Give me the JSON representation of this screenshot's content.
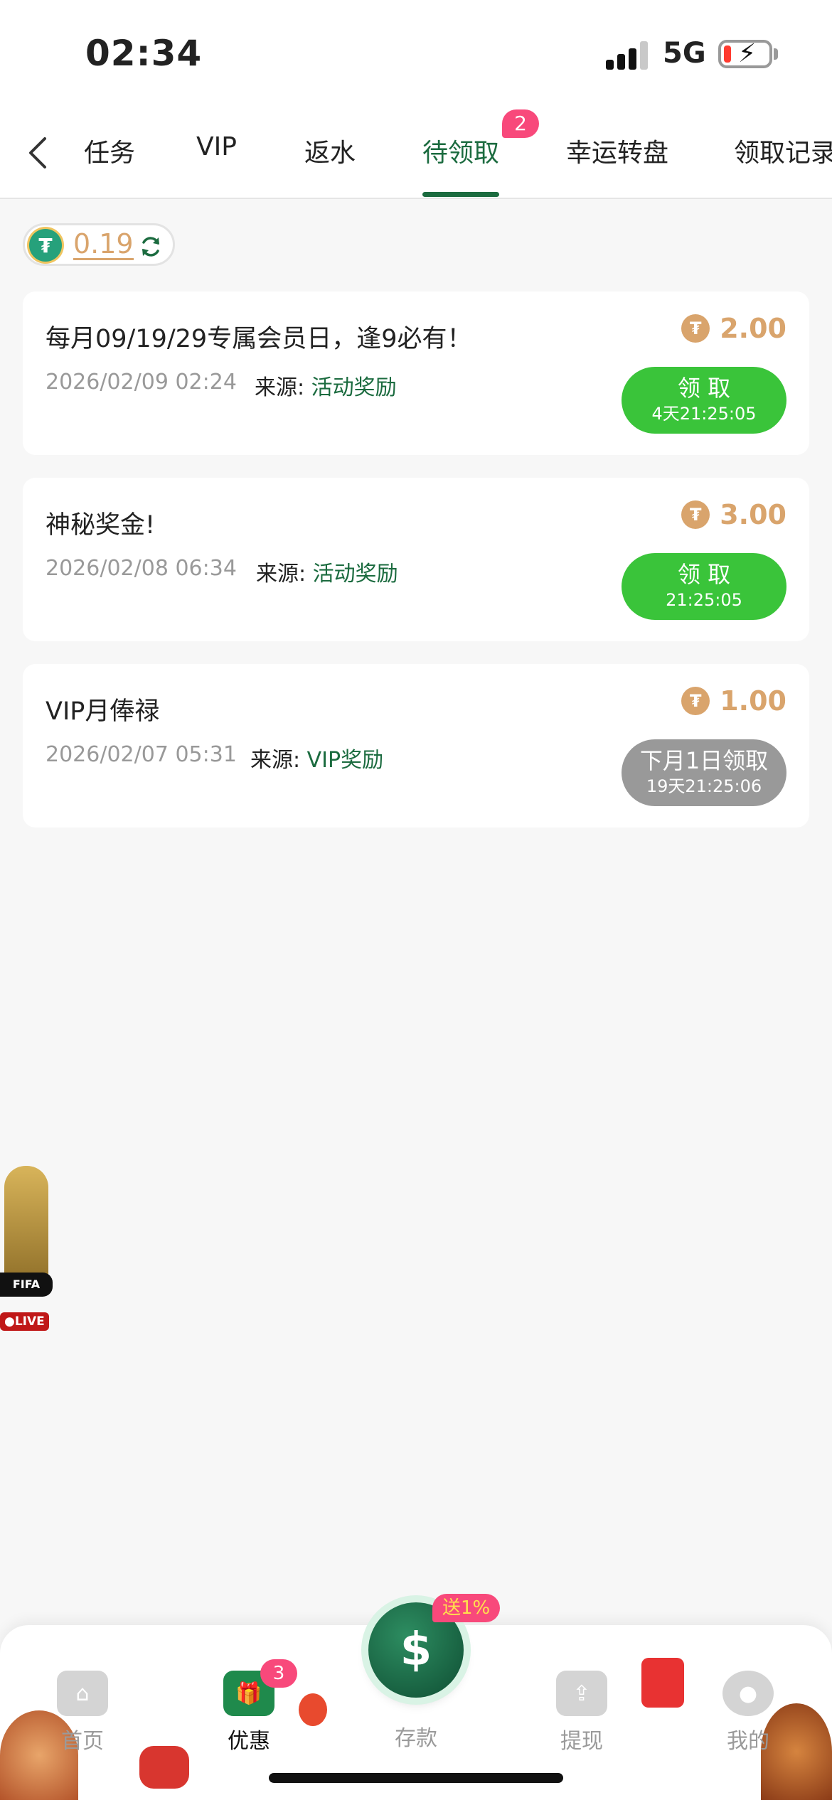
{
  "status_bar": {
    "time": "02:34",
    "network": "5G"
  },
  "tabs": [
    {
      "label": "任务"
    },
    {
      "label": "VIP"
    },
    {
      "label": "返水"
    },
    {
      "label": "待领取",
      "badge": "2"
    },
    {
      "label": "幸运转盘"
    },
    {
      "label": "领取记录"
    }
  ],
  "active_tab": "待领取",
  "balance": {
    "value": "0.19",
    "currency_icon": "usdt-icon"
  },
  "cards": [
    {
      "title": "每月09/19/29专属会员日，逢9必有！",
      "date": "2026/02/09 02:24",
      "source_label": "来源:",
      "source_value": "活动奖励",
      "amount": "2.00",
      "button_label": "领 取",
      "button_sub": "4天21:25:05",
      "button_state": "active"
    },
    {
      "title": "神秘奖金!",
      "date": "2026/02/08 06:34",
      "source_label": "来源:",
      "source_value": "活动奖励",
      "amount": "3.00",
      "button_label": "领 取",
      "button_sub": "21:25:05",
      "button_state": "active"
    },
    {
      "title": "VIP月俸禄",
      "date": "2026/02/07 05:31",
      "source_label": "来源:",
      "source_value": "VIP奖励",
      "amount": "1.00",
      "button_label": "下月1日领取",
      "button_sub": "19天21:25:06",
      "button_state": "disabled"
    }
  ],
  "floating_widget": {
    "band": "FIFA",
    "live": "●LIVE"
  },
  "bottom_nav": {
    "home": "首页",
    "offers": "优惠",
    "offers_badge": "3",
    "deposit": "存款",
    "deposit_promo": "送1%",
    "withdraw": "提现",
    "mine": "我的"
  },
  "colors": {
    "brand_green": "#1b6b3f",
    "claim_green": "#3ac43a",
    "amount_gold": "#d9a46c",
    "badge_pink": "#f8497b",
    "disabled_grey": "#999999"
  }
}
